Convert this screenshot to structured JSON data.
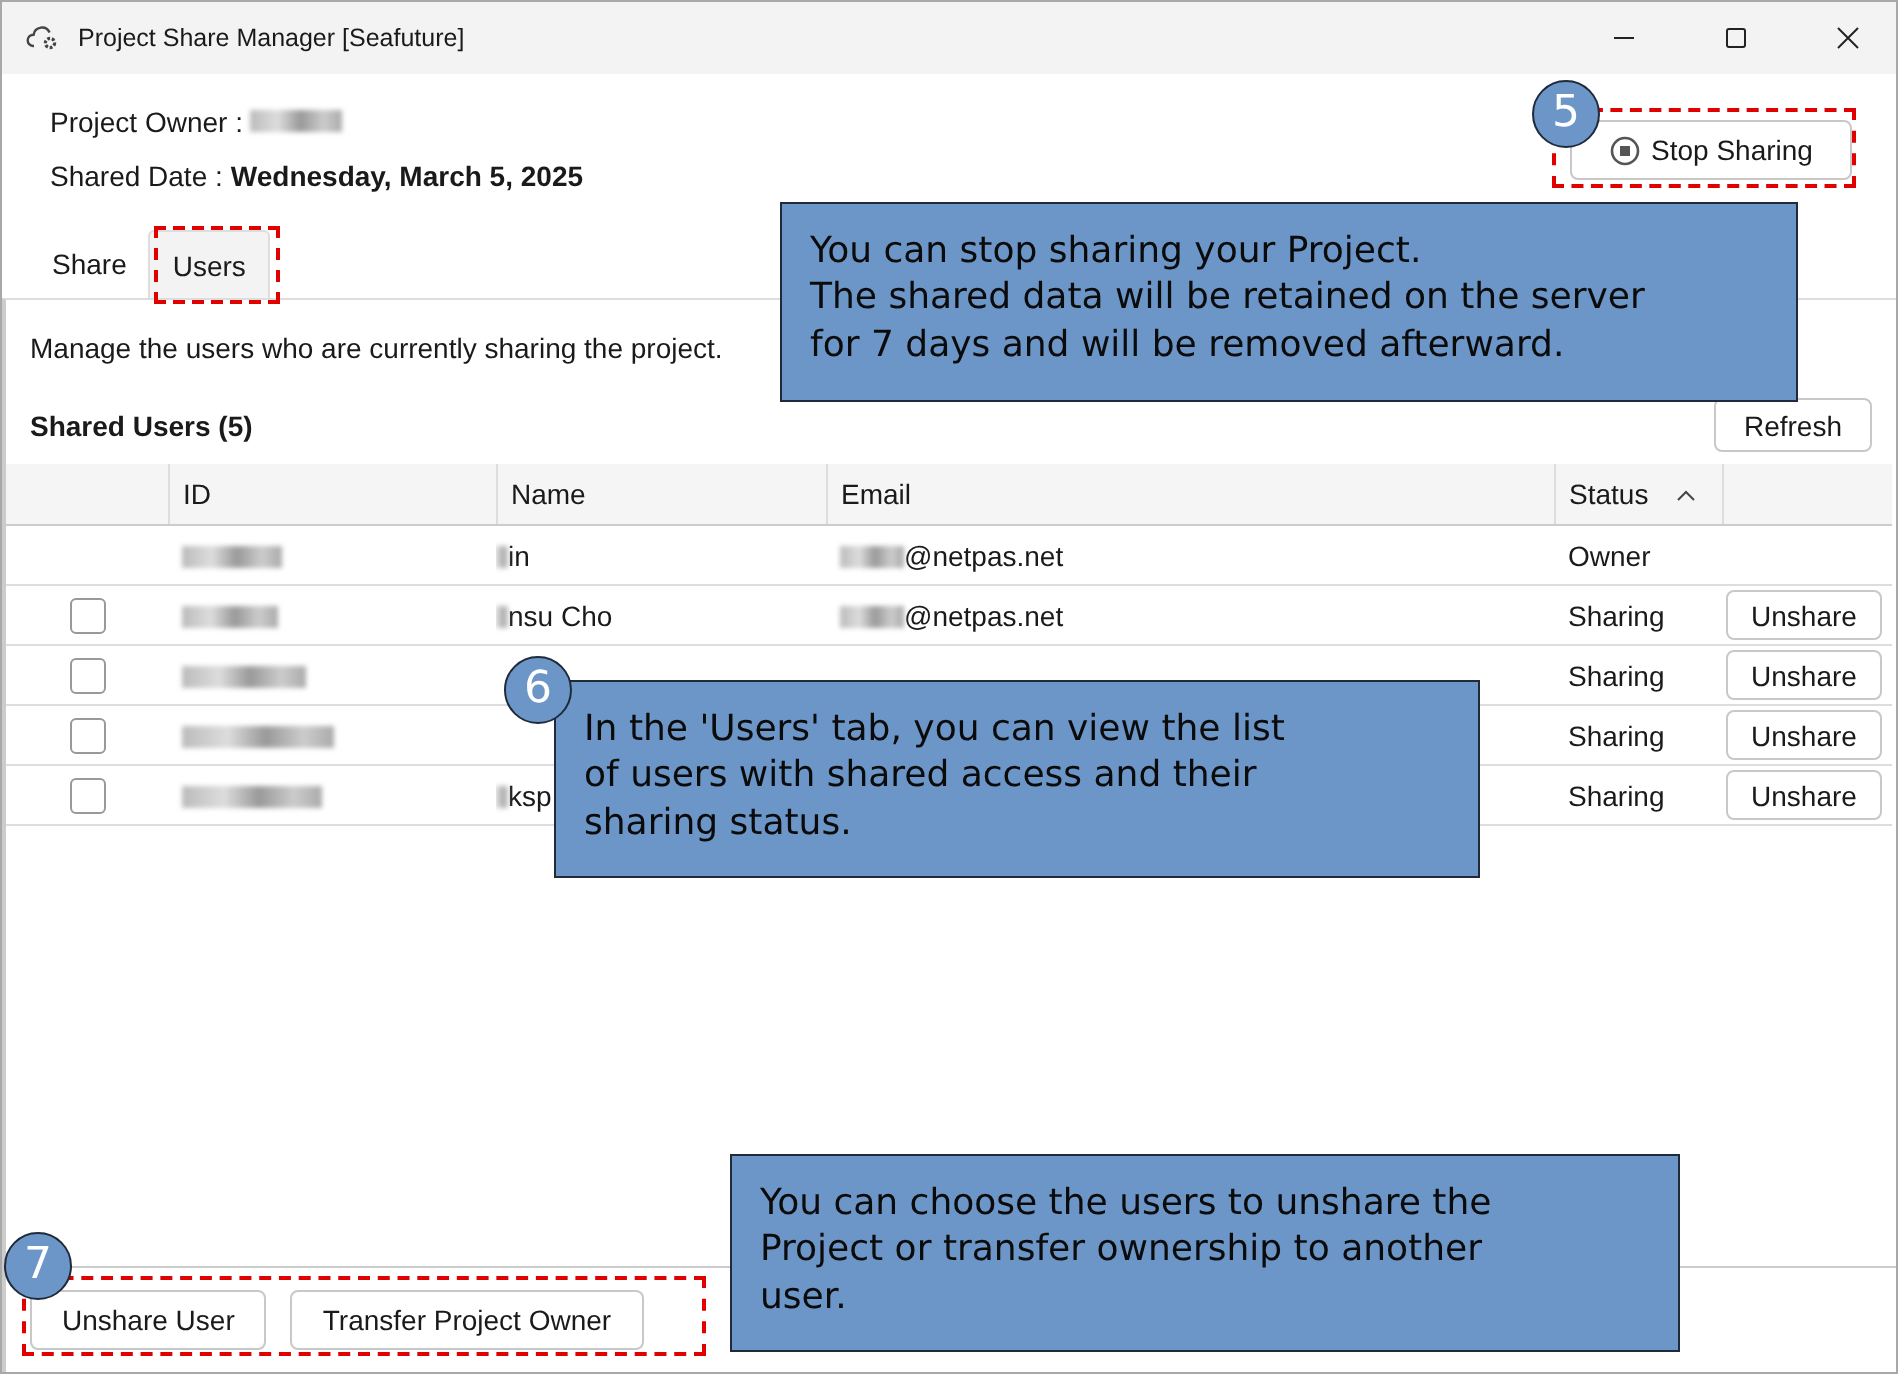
{
  "window": {
    "title": "Project Share Manager [Seafuture]"
  },
  "owner": {
    "label": "Project Owner :"
  },
  "shared_date": {
    "label": "Shared Date :",
    "value": "Wednesday, March 5, 2025"
  },
  "stop_button": {
    "label": "Stop Sharing"
  },
  "tabs": [
    {
      "label": "Share",
      "selected": false
    },
    {
      "label": "Users",
      "selected": true
    }
  ],
  "description": "Manage the users who are currently sharing the project.",
  "shared_users": {
    "title": "Shared Users",
    "count": "(5)"
  },
  "refresh_button": "Refresh",
  "table": {
    "columns": [
      {
        "label": "ID"
      },
      {
        "label": "Name"
      },
      {
        "label": "Email"
      },
      {
        "label": "Status",
        "sorted": true
      }
    ],
    "rows": [
      {
        "kind": "owner",
        "name": "in",
        "email": "@netpas.net",
        "status": "Owner"
      },
      {
        "kind": "member",
        "checked": false,
        "name": "nsu Cho",
        "email": "@netpas.net",
        "status": "Sharing",
        "action": "Unshare"
      },
      {
        "kind": "member",
        "checked": false,
        "status": "Sharing",
        "action": "Unshare"
      },
      {
        "kind": "member",
        "checked": false,
        "status": "Sharing",
        "action": "Unshare"
      },
      {
        "kind": "member",
        "checked": false,
        "name": "ksp",
        "status": "Sharing",
        "action": "Unshare"
      }
    ]
  },
  "footer_buttons": [
    "Unshare User",
    "Transfer Project Owner"
  ],
  "callouts": [
    {
      "kind": "stop",
      "number": "5",
      "text": "You can stop sharing your Project.\nThe shared data will be retained on the server\nfor 7 days and will be removed afterward."
    },
    {
      "kind": "users",
      "number": "6",
      "text": "In the 'Users' tab, you can view the list\nof users with shared access and their\nsharing status."
    },
    {
      "kind": "footer",
      "number": "7",
      "text": "You can choose the users to unshare the\nProject or transfer ownership to another\nuser."
    }
  ]
}
